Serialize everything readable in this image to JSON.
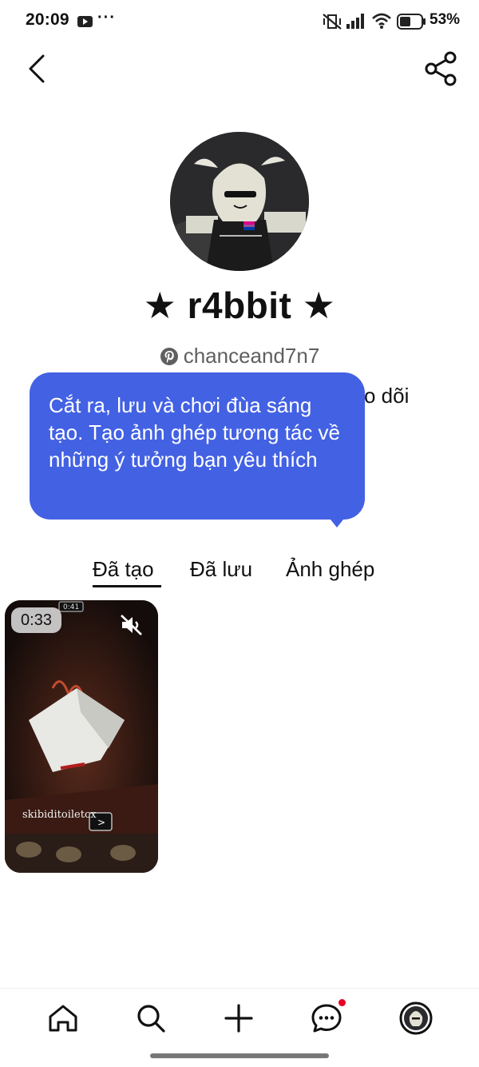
{
  "status_bar": {
    "time": "20:09",
    "more": "···",
    "battery_percent": "53%"
  },
  "profile": {
    "name": "★ r4bbit ★",
    "username": "chanceand7n7",
    "following_partial": "o dõi"
  },
  "tooltip": {
    "text": "Cắt ra, lưu và chơi đùa sáng tạo. Tạo ảnh ghép tương tác về những ý tưởng bạn yêu thích"
  },
  "tabs": [
    {
      "label": "Đã tạo",
      "active": true
    },
    {
      "label": "Đã lưu",
      "active": false
    },
    {
      "label": "Ảnh ghép",
      "active": false
    }
  ],
  "pins": [
    {
      "duration": "0:33",
      "muted": true,
      "small_timer": "0:41",
      "overlay_text": "skibiditoiletcx"
    }
  ],
  "bottom_nav": [
    {
      "icon": "home-icon"
    },
    {
      "icon": "search-icon"
    },
    {
      "icon": "plus-icon"
    },
    {
      "icon": "chat-icon",
      "badge": true
    },
    {
      "icon": "profile-avatar"
    }
  ],
  "colors": {
    "accent": "#4361e3",
    "notification": "#e60023",
    "text": "#111111",
    "secondary_text": "#5f5f5f"
  }
}
